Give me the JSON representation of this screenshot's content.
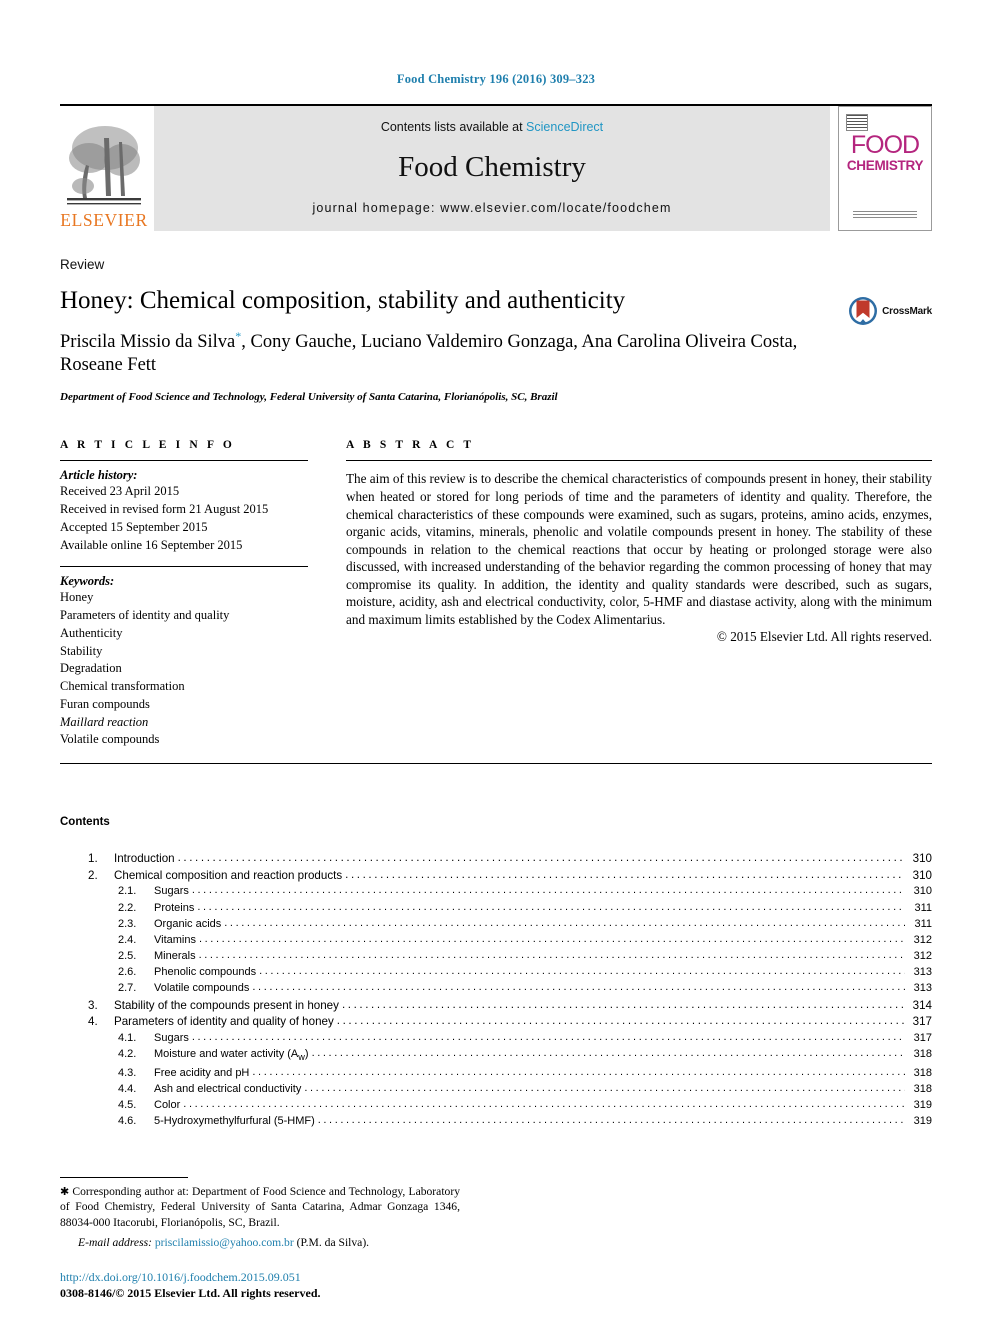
{
  "running_head": "Food Chemistry 196 (2016) 309–323",
  "masthead": {
    "contents_prefix": "Contents lists available at ",
    "sciencedirect": "ScienceDirect",
    "journal_title": "Food Chemistry",
    "homepage": "journal homepage: www.elsevier.com/locate/foodchem",
    "publisher_name": "ELSEVIER",
    "cover_line1": "FOOD",
    "cover_line2": "CHEMISTRY",
    "accent_link_color": "#2196c4",
    "publisher_color": "#E87722",
    "cover_color": "#b4257e"
  },
  "article": {
    "type": "Review",
    "title": "Honey: Chemical composition, stability and authenticity",
    "authors": "Priscila Missio da Silva *, Cony Gauche, Luciano Valdemiro Gonzaga, Ana Carolina Oliveira Costa, Roseane Fett",
    "affiliation": "Department of Food Science and Technology, Federal University of Santa Catarina, Florianópolis, SC, Brazil",
    "crossmark_label": "CrossMark"
  },
  "info": {
    "heading": "A R T I C L E    I N F O",
    "history_label": "Article history:",
    "history": [
      "Received 23 April 2015",
      "Received in revised form 21 August 2015",
      "Accepted 15 September 2015",
      "Available online 16 September 2015"
    ],
    "keywords_label": "Keywords:",
    "keywords": [
      "Honey",
      "Parameters of identity and quality",
      "Authenticity",
      "Stability",
      "Degradation",
      "Chemical transformation",
      "Furan compounds",
      "Maillard reaction",
      "Volatile compounds"
    ]
  },
  "abstract": {
    "heading": "A B S T R A C T",
    "body": "The aim of this review is to describe the chemical characteristics of compounds present in honey, their stability when heated or stored for long periods of time and the parameters of identity and quality. Therefore, the chemical characteristics of these compounds were examined, such as sugars, proteins, amino acids, enzymes, organic acids, vitamins, minerals, phenolic and volatile compounds present in honey. The stability of these compounds in relation to the chemical reactions that occur by heating or prolonged storage were also discussed, with increased understanding of the behavior regarding the common processing of honey that may compromise its quality. In addition, the identity and quality standards were described, such as sugars, moisture, acidity, ash and electrical conductivity, color, 5-HMF and diastase activity, along with the minimum and maximum limits established by the Codex Alimentarius.",
    "copyright": "© 2015 Elsevier Ltd. All rights reserved."
  },
  "contents": {
    "heading": "Contents",
    "entries": [
      {
        "num": "1.",
        "label": "Introduction",
        "page": "310",
        "level": 0
      },
      {
        "num": "2.",
        "label": "Chemical composition and reaction products",
        "page": "310",
        "level": 0
      },
      {
        "num": "2.1.",
        "label": "Sugars",
        "page": "310",
        "level": 2
      },
      {
        "num": "2.2.",
        "label": "Proteins",
        "page": "311",
        "level": 2
      },
      {
        "num": "2.3.",
        "label": "Organic acids",
        "page": "311",
        "level": 2
      },
      {
        "num": "2.4.",
        "label": "Vitamins",
        "page": "312",
        "level": 2
      },
      {
        "num": "2.5.",
        "label": "Minerals",
        "page": "312",
        "level": 2
      },
      {
        "num": "2.6.",
        "label": "Phenolic compounds",
        "page": "313",
        "level": 2
      },
      {
        "num": "2.7.",
        "label": "Volatile compounds",
        "page": "313",
        "level": 2
      },
      {
        "num": "3.",
        "label": "Stability of the compounds present in honey",
        "page": "314",
        "level": 0
      },
      {
        "num": "4.",
        "label": "Parameters of identity and quality of honey",
        "page": "317",
        "level": 0
      },
      {
        "num": "4.1.",
        "label": "Sugars",
        "page": "317",
        "level": 2
      },
      {
        "num": "4.2.",
        "label": "Moisture and water activity (Aw)",
        "page": "318",
        "level": 2
      },
      {
        "num": "4.3.",
        "label": "Free acidity and pH",
        "page": "318",
        "level": 2
      },
      {
        "num": "4.4.",
        "label": "Ash and electrical conductivity",
        "page": "318",
        "level": 2
      },
      {
        "num": "4.5.",
        "label": "Color",
        "page": "319",
        "level": 2
      },
      {
        "num": "4.6.",
        "label": "5-Hydroxymethylfurfural (5-HMF)",
        "page": "319",
        "level": 2
      }
    ]
  },
  "footnotes": {
    "corresponding": "* Corresponding author at: Department of Food Science and Technology, Laboratory of Food Chemistry, Federal University of Santa Catarina, Admar Gonzaga 1346, 88034-000 Itacorubi, Florianópolis, SC, Brazil.",
    "email_label": "E-mail address:",
    "email": "priscilamissio@yahoo.com.br",
    "email_suffix": "(P.M. da Silva).",
    "doi": "http://dx.doi.org/10.1016/j.foodchem.2015.09.051",
    "issn_line": "0308-8146/© 2015 Elsevier Ltd. All rights reserved."
  }
}
